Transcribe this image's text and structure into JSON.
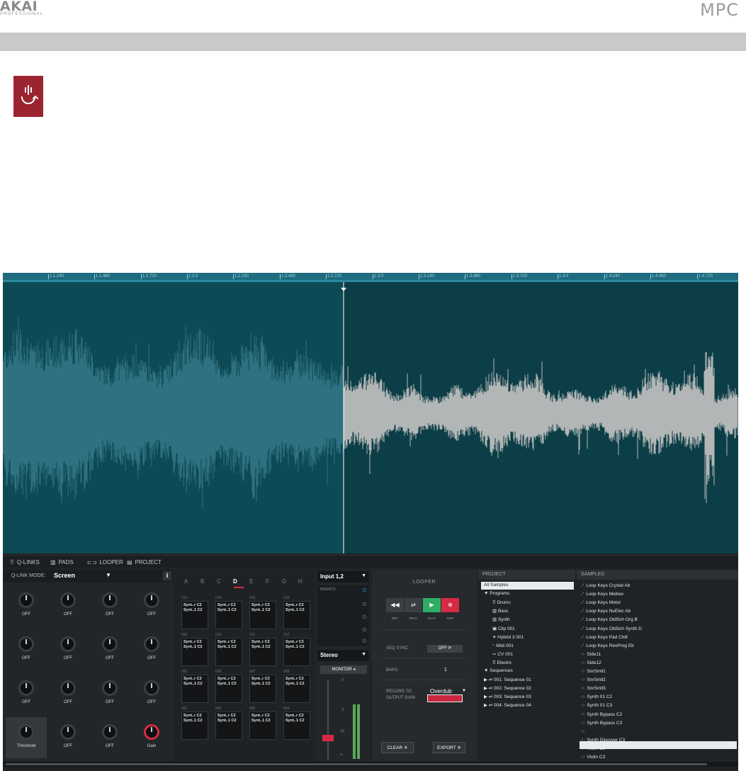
{
  "header": {
    "brand_left": "AKAI",
    "brand_left_sub": "PROFESSIONAL",
    "brand_right": "MPC"
  },
  "colors": {
    "section_bar": "#c9c9c9",
    "icon_bg": "#9b2430",
    "accent_red": "#d62b45",
    "waveform_bg": "#0c3e47",
    "timeline": "#1f6b7f"
  },
  "ruler_ticks": [
    "1.1.240",
    "1.1.480",
    "1.1.720",
    "1.2.0",
    "1.2.240",
    "1.2.480",
    "1.2.720",
    "1.3.0",
    "1.3.240",
    "1.3.480",
    "1.3.720",
    "1.4.0",
    "1.4.240",
    "1.4.480",
    "1.4.720"
  ],
  "tabs": [
    {
      "icon": "grid-icon",
      "label": "Q-LINKS"
    },
    {
      "icon": "pads-icon",
      "label": "PADS"
    },
    {
      "icon": "looper-icon",
      "label": "LOOPER"
    },
    {
      "icon": "project-icon",
      "label": "PROJECT"
    }
  ],
  "qlink": {
    "mode_label": "Q-LINK MODE:",
    "mode_value": "Screen",
    "info": "i",
    "knobs": [
      "OFF",
      "OFF",
      "OFF",
      "OFF",
      "OFF",
      "OFF",
      "OFF",
      "OFF",
      "OFF",
      "OFF",
      "OFF",
      "OFF",
      "Threshold",
      "OFF",
      "OFF",
      "Gain"
    ]
  },
  "pads": {
    "banks": [
      "A",
      "B",
      "C",
      "D",
      "E",
      "F",
      "G",
      "H"
    ],
    "selected_bank": "D",
    "rows": [
      {
        "nums": [
          "013",
          "014",
          "015",
          "016"
        ],
        "l1": [
          "Synt..r C2",
          "Synt..r C2",
          "Synt..r C2",
          "Synt..r C2"
        ],
        "l2": [
          "Synt..1 C2",
          "Synt..1 C2",
          "Synt..1 C2",
          "Synt..1 C2"
        ]
      },
      {
        "nums": [
          "009",
          "010",
          "011",
          "012"
        ],
        "l1": [
          "Synt..r C2",
          "Synt..r C2",
          "Synt..r C2",
          "Synt..r C2"
        ],
        "l2": [
          "Synt..1 C2",
          "Synt..1 C2",
          "Synt..1 C2",
          "Synt..1 C2"
        ]
      },
      {
        "nums": [
          "005",
          "006",
          "007",
          "008"
        ],
        "l1": [
          "Synt..r C2",
          "Synt..r C2",
          "Synt..r C2",
          "Synt..r C2"
        ],
        "l2": [
          "Synt..1 C2",
          "Synt..1 C2",
          "Synt..1 C2",
          "Synt..1 C2"
        ]
      },
      {
        "nums": [
          "001",
          "002",
          "003",
          "004"
        ],
        "l1": [
          "Synt..r C2",
          "Synt..r C2",
          "Synt..r C2",
          "Synt..r C2"
        ],
        "l2": [
          "Synt..1 C2",
          "Synt..1 C2",
          "Synt..1 C2",
          "Synt..1 C2"
        ]
      }
    ]
  },
  "input": {
    "source": "Input 1,2",
    "inserts_label": "INSERTS",
    "mode": "Stereo",
    "monitor_label": "MONITOR ◂",
    "db_labels": [
      "0",
      "-3",
      "-20",
      "-∞"
    ]
  },
  "looper": {
    "title": "LOOPER",
    "buttons": [
      {
        "label": "REV",
        "glyph": "◀◀"
      },
      {
        "label": "RPLC",
        "glyph": "⇄"
      },
      {
        "label": "PLAY",
        "glyph": "▶"
      },
      {
        "label": "OVR",
        "glyph": "⊕"
      }
    ],
    "seq_sync_label": "SEQ SYNC",
    "seq_sync_value": "OFF ⟳",
    "bars_label": "BARS",
    "bars_value": "1",
    "record_to_label": "RECORD TO",
    "record_to_value": "Overdub",
    "output_gain_label": "OUTPUT GAIN",
    "clear_label": "CLEAR ✕",
    "export_label": "EXPORT ✕"
  },
  "project": {
    "header": "PROJECT",
    "items": [
      {
        "text": "All Samples",
        "indent": 0
      },
      {
        "text": "▼ Programs",
        "indent": 0
      },
      {
        "text": "⠿ Drums",
        "indent": 2
      },
      {
        "text": "▥ Bass",
        "indent": 2
      },
      {
        "text": "▥ Synth",
        "indent": 2
      },
      {
        "text": "▣ Clip 001",
        "indent": 2
      },
      {
        "text": "✦ Hybrid 3 001",
        "indent": 2
      },
      {
        "text": "⁼ Midi 001",
        "indent": 2
      },
      {
        "text": "∾ CV 001",
        "indent": 2
      },
      {
        "text": "⠿ Electro",
        "indent": 2
      },
      {
        "text": "▼ Sequences",
        "indent": 0
      },
      {
        "text": "▶   ⇌ 001: Sequence 01",
        "indent": 0
      },
      {
        "text": "▶   ⇌ 002: Sequence 02",
        "indent": 0
      },
      {
        "text": "▶   ⇌ 003: Sequence 03",
        "indent": 0
      },
      {
        "text": "▶   ⇌ 004: Sequence 04",
        "indent": 0
      }
    ]
  },
  "samples": {
    "header": "SAMPLES",
    "items": [
      "Loop Keys Crystal Ab",
      "Loop Keys Mellow",
      "Loop Keys Motor",
      "Loop Keys NuElec Ab",
      "Loop Keys OldSch Org B",
      "Loop Keys OldSch Synth D",
      "Loop Keys Pad Chill",
      "Loop Keys RevProg Eb",
      "Side11",
      "Side12",
      "SnrSmll1",
      "SnrSmll2",
      "SnrSmll3",
      "Synth 01 C2",
      "Synth 01 C3",
      "Synth Bypass C2",
      "Synth Bypass C3",
      "Synth Discover C2",
      "Synth Discover C3",
      "Violin C2",
      "Violin C3"
    ],
    "selected_index": 17
  }
}
